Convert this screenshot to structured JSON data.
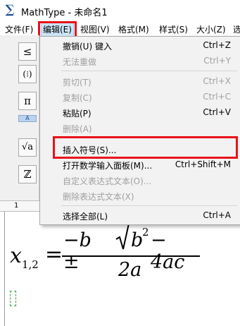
{
  "window": {
    "app_icon": "∑",
    "title": "MathType - 未命名1"
  },
  "menubar": {
    "items": [
      {
        "label": "文件(F)"
      },
      {
        "label": "编辑(E)"
      },
      {
        "label": "视图(V)"
      },
      {
        "label": "格式(M)"
      },
      {
        "label": "样式(S)"
      },
      {
        "label": "大小(Z)"
      },
      {
        "label": "选"
      }
    ]
  },
  "toolbar": {
    "buttons": [
      "≤",
      "(⁝)",
      "π",
      "√a",
      "ℤ"
    ],
    "tab_label": "A"
  },
  "ruler": {
    "label": "1"
  },
  "edit_menu": {
    "items": [
      {
        "label": "撤销(U) 键入",
        "shortcut": "Ctrl+Z",
        "enabled": true
      },
      {
        "label": "无法重做",
        "shortcut": "Ctrl+Y",
        "enabled": false
      },
      {
        "label": "剪切(T)",
        "shortcut": "Ctrl+X",
        "enabled": false
      },
      {
        "label": "复制(C)",
        "shortcut": "Ctrl+C",
        "enabled": false
      },
      {
        "label": "粘贴(P)",
        "shortcut": "Ctrl+V",
        "enabled": true
      },
      {
        "label": "删除(A)",
        "shortcut": "",
        "enabled": false
      },
      {
        "label": "插入符号(S)...",
        "shortcut": "",
        "enabled": true
      },
      {
        "label": "打开数学输入面板(M)...",
        "shortcut": "Ctrl+Shift+M",
        "enabled": true
      },
      {
        "label": "自定义表达式文本(O)...",
        "shortcut": "",
        "enabled": false
      },
      {
        "label": "删除表达式文本(X)",
        "shortcut": "",
        "enabled": false
      },
      {
        "label": "选择全部(L)",
        "shortcut": "Ctrl+A",
        "enabled": true
      }
    ]
  },
  "formula": {
    "lhs_var": "x",
    "lhs_sub": "1,2",
    "equals": "=",
    "num_part1": "−b ±",
    "radicand_base": "b",
    "radicand_exp": "2",
    "radicand_rest": "− 4ac",
    "denominator": "2a"
  },
  "colors": {
    "highlight": "#e8121b",
    "menu_bg": "#f2f2f2",
    "active_menu": "#cce4f7"
  }
}
